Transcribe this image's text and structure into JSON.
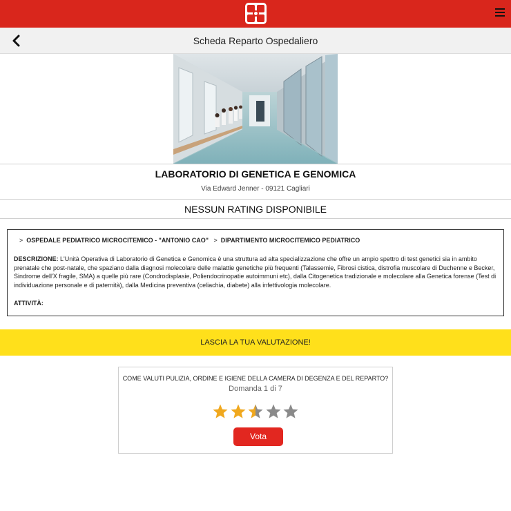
{
  "header": {
    "logo": "logo-icon",
    "menu_icon": "hamburger-menu-icon"
  },
  "nav": {
    "title": "Scheda Reparto Ospedaliero",
    "back_icon": "chevron-left-icon"
  },
  "ward": {
    "name": "LABORATORIO DI GENETICA E GENOMICA",
    "address": "Via Edward Jenner - 09121 Cagliari",
    "rating_text": "NESSUN RATING DISPONIBILE"
  },
  "details": {
    "breadcrumb": [
      {
        "separator": ">",
        "label": "OSPEDALE PEDIATRICO MICROCITEMICO - \"ANTONIO CAO\""
      },
      {
        "separator": ">",
        "label": "DIPARTIMENTO MICROCITEMICO PEDIATRICO"
      }
    ],
    "description_label": "DESCRIZIONE:",
    "description_text": " L'Unità Operativa di Laboratorio di Genetica e Genomica è una struttura ad alta specializzazione che offre un ampio spettro di test genetici sia in ambito prenatale che post-natale, che spaziano dalla diagnosi molecolare delle malattie genetiche più frequenti (Talassemie, Fibrosi cistica, distrofia muscolare di Duchenne e Becker, Sindrome dell'X fragile, SMA) a quelle più rare (Condrodisplasie, Poliendocrinopatie autoimmuni etc), dalla Citogenetica tradizionale e molecolare alla Genetica forense (Test di individuazione personale e di paternità), dalla Medicina preventiva (celiachia, diabete) alla infettivologia molecolare.",
    "activity_label": "ATTIVITÀ:"
  },
  "cta": {
    "label": "LASCIA LA TUA VALUTAZIONE!"
  },
  "survey": {
    "question": "COME VALUTI PULIZIA, ORDINE E IGIENE DELLA CAMERA DI DEGENZA E DEL REPARTO?",
    "counter": "Domanda 1 di 7",
    "rating": 2.5,
    "max_rating": 5,
    "vote_label": "Vota"
  },
  "colors": {
    "brand_red": "#d9261c",
    "cta_yellow": "#ffe01b",
    "star_filled": "#f0a81e",
    "star_empty": "#8a8a8a",
    "vote_button": "#e22720"
  }
}
